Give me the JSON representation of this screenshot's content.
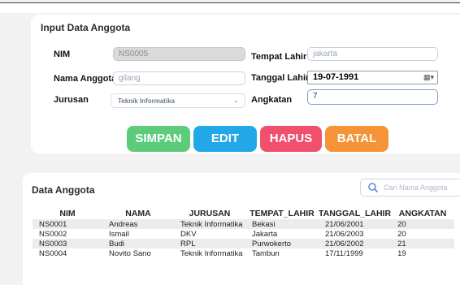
{
  "input_panel": {
    "title": "Input Data Anggota",
    "nim_label": "NIM",
    "nim_value": "NS0005",
    "nama_label": "Nama Anggota",
    "nama_value": "gilang",
    "jurusan_label": "Jurusan",
    "jurusan_value": "Teknik Informatika",
    "tempat_label": "Tempat Lahir",
    "tempat_value": "jakarta",
    "tanggal_label": "Tanggal Lahir",
    "tanggal_value": "19-07-1991",
    "angkatan_label": "Angkatan",
    "angkatan_value": "7"
  },
  "buttons": {
    "simpan": "SIMPAN",
    "edit": "EDIT",
    "hapus": "HAPUS",
    "batal": "BATAL"
  },
  "colors": {
    "simpan": "#5ccc7a",
    "edit": "#22a8e8",
    "hapus": "#f0506e",
    "batal": "#f59436"
  },
  "data_panel": {
    "title": "Data Anggota",
    "search_placeholder": "Cari Nama Anggota",
    "columns": [
      "NIM",
      "NAMA",
      "JURUSAN",
      "TEMPAT_LAHIR",
      "TANGGAL_LAHIR",
      "ANGKATAN"
    ],
    "rows": [
      [
        "NS0001",
        "Andreas",
        "Teknik Informatika",
        "Bekasi",
        "21/06/2001",
        "20"
      ],
      [
        "NS0002",
        "Ismail",
        "DKV",
        "Jakarta",
        "21/06/2003",
        "20"
      ],
      [
        "NS0003",
        "Budi",
        "RPL",
        "Purwokerto",
        "21/06/2002",
        "21"
      ],
      [
        "NS0004",
        "Novito Sano",
        "Teknik Informatika",
        "Tambun",
        "17/11/1999",
        "19"
      ]
    ]
  }
}
